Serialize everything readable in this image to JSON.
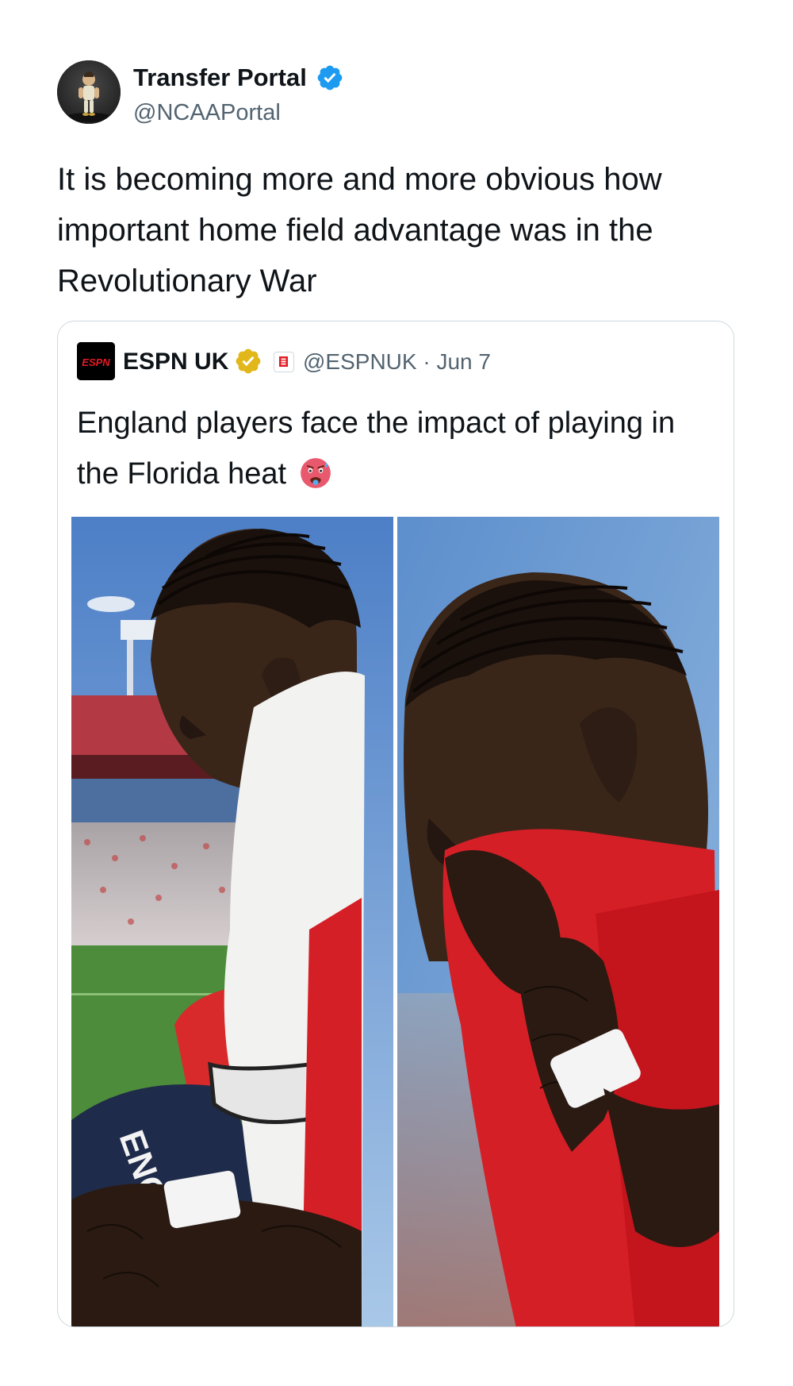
{
  "tweet": {
    "author": {
      "name": "Transfer Portal",
      "handle": "@NCAAPortal",
      "verified": true,
      "avatar_icon": "animated-player-avatar"
    },
    "text": "It is becoming more and more obvious how important home field advantage was in the Revolutionary War",
    "quoted_tweet": {
      "author": {
        "name": "ESPN UK",
        "logo_text": "ESPN",
        "verified": "gold",
        "affiliate_icon": "espn-affiliate-badge-icon"
      },
      "meta": "@ESPNUK · Jun 7",
      "text": "England players face the impact of playing in the Florida heat",
      "emoji": "hot-face-emoji",
      "photos": [
        {
          "icon": "player-wiping-face-with-towel-photo",
          "shirt_text": "ENGLAND"
        },
        {
          "icon": "player-wiping-face-with-shirt-photo"
        }
      ]
    }
  },
  "colors": {
    "text": "#0f1419",
    "secondary": "#536471",
    "verified_blue": "#1d9bf0",
    "verified_gold": "#e2b719",
    "border": "#cfd9de",
    "england_red": "#d51f26"
  }
}
